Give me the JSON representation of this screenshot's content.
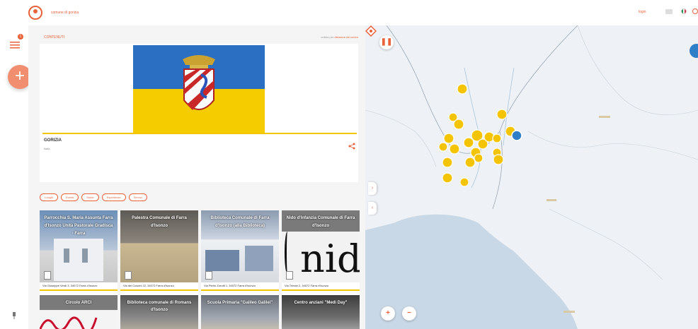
{
  "header": {
    "site_link": "comune di gorizia",
    "right_link": "login",
    "lang_colors": [
      "#009246",
      "#ffffff",
      "#ce2b37"
    ]
  },
  "rail": {
    "menu_badge": "1",
    "add_label": "+"
  },
  "panel": {
    "head_label": "CONTENUTI",
    "head_right_prefix": "ordina per",
    "head_right_accent": "distanza dal centro",
    "place_name": "GORIZIA",
    "place_sub": "Italia",
    "filters": [
      "Luoghi",
      "Eventi",
      "Storie",
      "Esperienze",
      "Servizi"
    ],
    "tiles": [
      {
        "title": "Parrocchia S. Maria Assunta Farra d'Isonzo Unità Pastorale Gradisca - Farra",
        "addr": "Via Giuseppe Verdi 3, 34072 Farra d'Isonzo"
      },
      {
        "title": "Palestra Comunale di Farra d'Isonzo",
        "addr": "Via dei Cuscini 22, 34072 Farra d'Isonzo"
      },
      {
        "title": "Biblioteca Comunale di Farra d'Isonzo (alla Biblioteca)",
        "addr": "Via Pietro Zorutti 1, 34072 Farra d'Isonzo"
      },
      {
        "title": "Nido d'Infanzia Comunale di Farra d'Isonzo",
        "addr": "Via Trieste 2, 34072 Farra d'Isonzo"
      }
    ],
    "tiles2": [
      {
        "title": "Circolo ARCI"
      },
      {
        "title": "Biblioteca comunale di Romans d'Isonzo"
      },
      {
        "title": "Scuola Primaria \"Galileo Galilei\""
      },
      {
        "title": "Centro anziani \"Medi Day\""
      }
    ]
  },
  "map": {
    "pause_label": "❚❚",
    "zoom_in_label": "+",
    "zoom_out_label": "−",
    "marker_color": "#f5c400",
    "active_marker_color": "#2f7ec8"
  }
}
